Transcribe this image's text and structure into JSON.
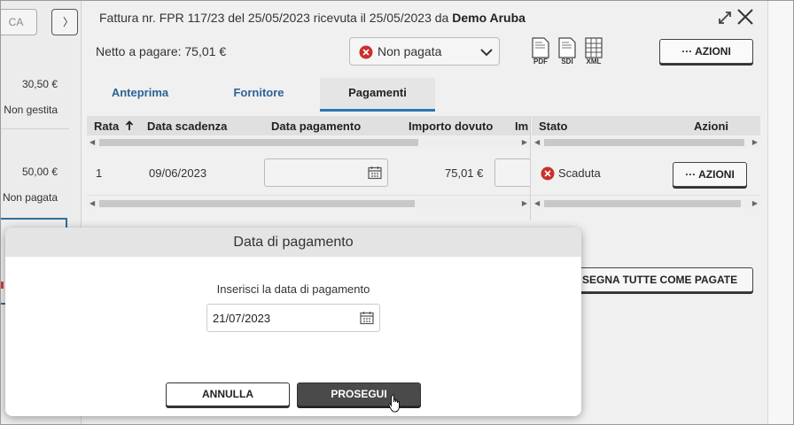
{
  "background": {
    "btn_a": "CA",
    "btn_b": "",
    "rows": [
      {
        "amount": "30,50 €",
        "status": "Non gestita"
      },
      {
        "amount": "50,00 €",
        "status": "Non pagata"
      }
    ]
  },
  "header": {
    "title_prefix": "Fattura nr. FPR 117/23 del 25/05/2023 ricevuta il 25/05/2023 da ",
    "title_supplier": "Demo Aruba",
    "net_label": "Netto a pagare: 75,01 €",
    "status_value": "Non pagata",
    "doc_icons": [
      "PDF",
      "SDI",
      "XML"
    ],
    "actions_label": "AZIONI"
  },
  "tabs": [
    {
      "label": "Anteprima",
      "active": false
    },
    {
      "label": "Fornitore",
      "active": false
    },
    {
      "label": "Pagamenti",
      "active": true
    }
  ],
  "table": {
    "columns_left": [
      "Rata",
      "Data scadenza",
      "Data pagamento",
      "Importo dovuto",
      "Im"
    ],
    "columns_right": [
      "Stato",
      "Azioni"
    ],
    "rows": [
      {
        "rata": "1",
        "scadenza": "09/06/2023",
        "pagamento": "",
        "importo": "75,01 €",
        "stato": "Scaduta",
        "azioni": "AZIONI"
      }
    ],
    "mark_all_label": "SEGNA TUTTE COME PAGATE"
  },
  "modal": {
    "title": "Data di pagamento",
    "prompt": "Inserisci la data di pagamento",
    "date_value": "21/07/2023",
    "cancel_label": "ANNULLA",
    "confirm_label": "PROSEGUI"
  },
  "colors": {
    "accent_blue": "#2a77b8",
    "status_red": "#c9302c",
    "primary_dark": "#4a4a4a"
  },
  "icons": [
    "expand-icon",
    "close-icon",
    "error-icon",
    "chevron-down-icon",
    "pdf-icon",
    "sdi-icon",
    "xml-icon",
    "calendar-icon",
    "sort-arrow-icon",
    "hand-cursor-icon"
  ]
}
